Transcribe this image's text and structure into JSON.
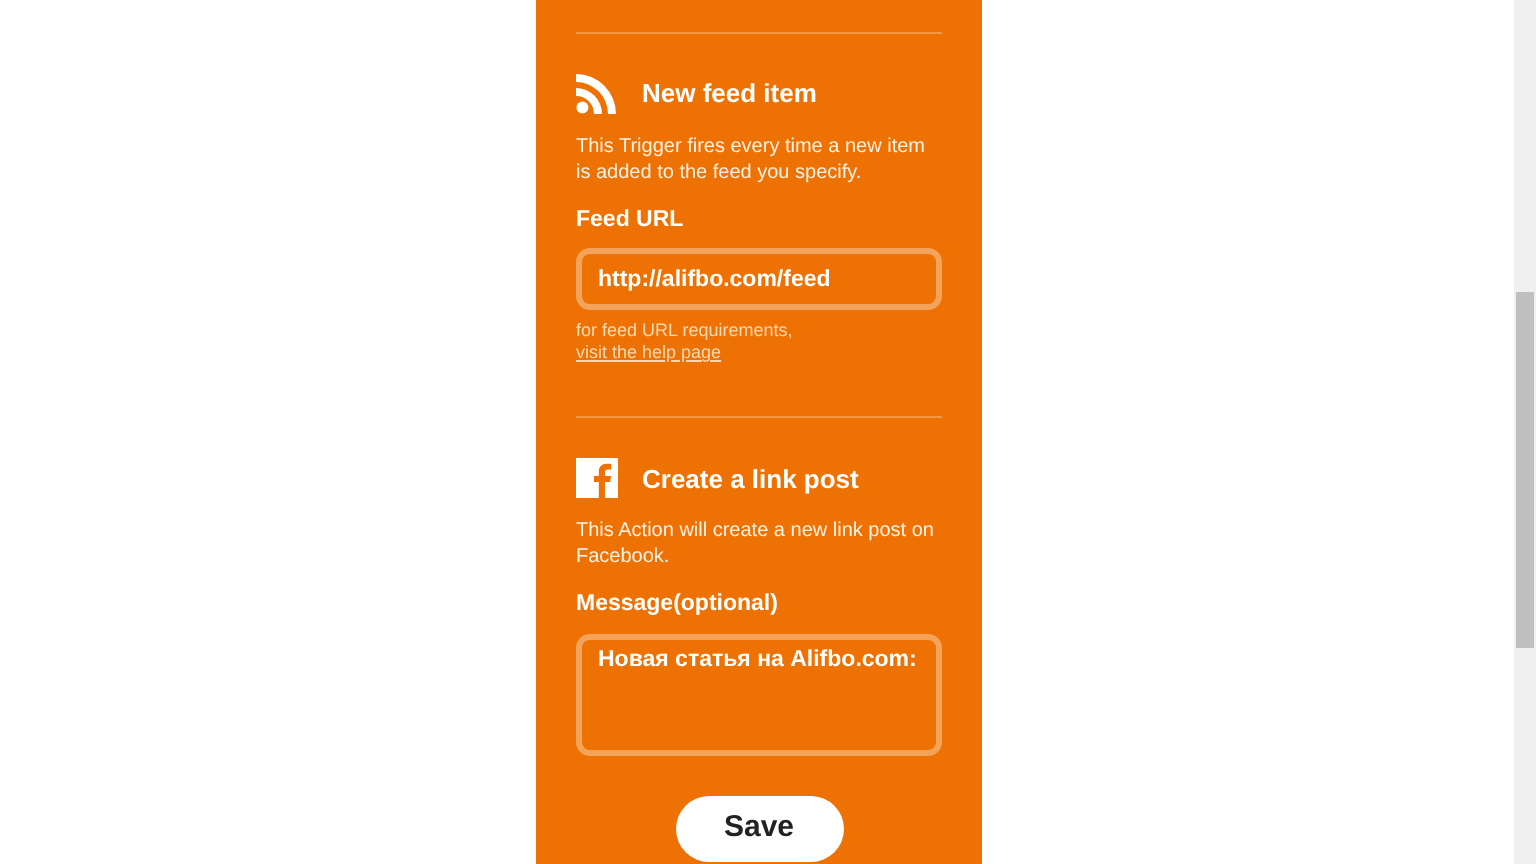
{
  "sections": [
    {
      "kind": "trigger",
      "title": "New feed item",
      "description": "This Trigger fires every time a new item is added to the feed you specify.",
      "field": {
        "label": "Feed URL",
        "kind": "line",
        "value": "http://alifbo.com/feed"
      },
      "help": {
        "text": "for feed URL requirements, ",
        "link": "visit the help page"
      }
    },
    {
      "kind": "action",
      "title": "Create a link post",
      "description": "This Action will create a new link post on Facebook.",
      "field": {
        "label": "Message(optional)",
        "kind": "area",
        "value": "Новая статья на Alifbo.com:"
      }
    }
  ],
  "save_button": "Save"
}
